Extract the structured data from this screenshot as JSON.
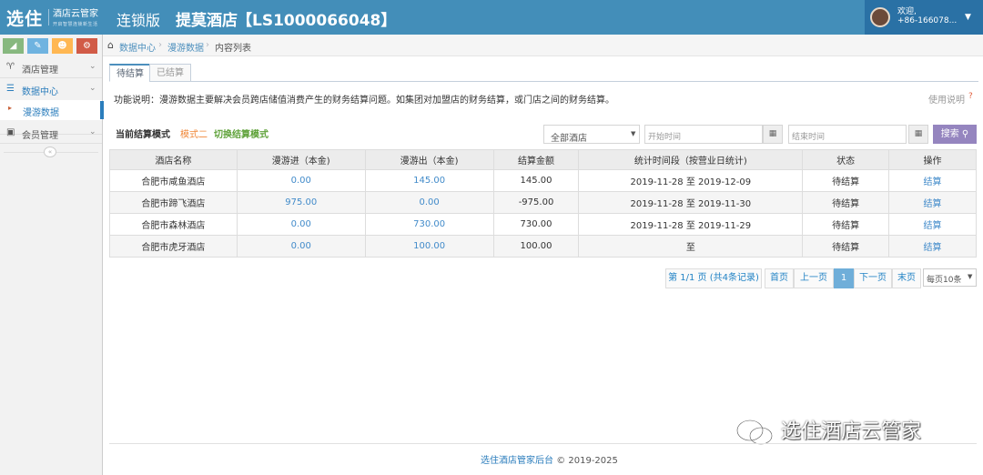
{
  "header": {
    "logo": "选住",
    "logo_sub": "酒店云管家",
    "logo_sub2": "开启智慧连锁新生活",
    "chain": "连锁版",
    "hotel": "提莫酒店",
    "id": "【LS1000066048】",
    "welcome": "欢迎,",
    "phone": "+86-166078..."
  },
  "sidebar": {
    "items": [
      {
        "label": "酒店管理"
      },
      {
        "label": "数据中心"
      },
      {
        "label": "漫游数据"
      },
      {
        "label": "会员管理"
      }
    ]
  },
  "breadcrumb": {
    "home": "数据中心",
    "sep": "›",
    "level2": "漫游数据",
    "current": "内容列表"
  },
  "tabs": [
    {
      "label": "待结算"
    },
    {
      "label": "已结算"
    }
  ],
  "desc": "功能说明：漫游数据主要解决会员跨店储值消费产生的财务结算问题。如集团对加盟店的财务结算，或门店之间的财务结算。",
  "help": "使用说明",
  "mode": {
    "label": "当前结算模式",
    "value": "模式二",
    "switch": "切换结算模式"
  },
  "filters": {
    "hotel": "全部酒店",
    "start": "开始时间",
    "end": "结束时间",
    "search": "搜索"
  },
  "table": {
    "headers": [
      "酒店名称",
      "漫游进（本金)",
      "漫游出（本金)",
      "结算金额",
      "统计时间段（按营业日统计)",
      "状态",
      "操作"
    ],
    "rows": [
      [
        "合肥市咸鱼酒店",
        "0.00",
        "145.00",
        "145.00",
        "2019-11-28 至 2019-12-09",
        "待结算",
        "结算"
      ],
      [
        "合肥市蹄飞酒店",
        "975.00",
        "0.00",
        "-975.00",
        "2019-11-28 至 2019-11-30",
        "待结算",
        "结算"
      ],
      [
        "合肥市森林酒店",
        "0.00",
        "730.00",
        "730.00",
        "2019-11-28 至 2019-11-29",
        "待结算",
        "结算"
      ],
      [
        "合肥市虎牙酒店",
        "0.00",
        "100.00",
        "100.00",
        "至",
        "待结算",
        "结算"
      ]
    ]
  },
  "pagination": {
    "info": "第 1/1 页 (共4条记录)",
    "first": "首页",
    "prev": "上一页",
    "page": "1",
    "next": "下一页",
    "last": "末页",
    "per_page": "每页10条"
  },
  "footer": {
    "brand": "选住酒店管家后台",
    "copy": "© 2019-2025"
  },
  "watermark": "选住酒店云管家"
}
